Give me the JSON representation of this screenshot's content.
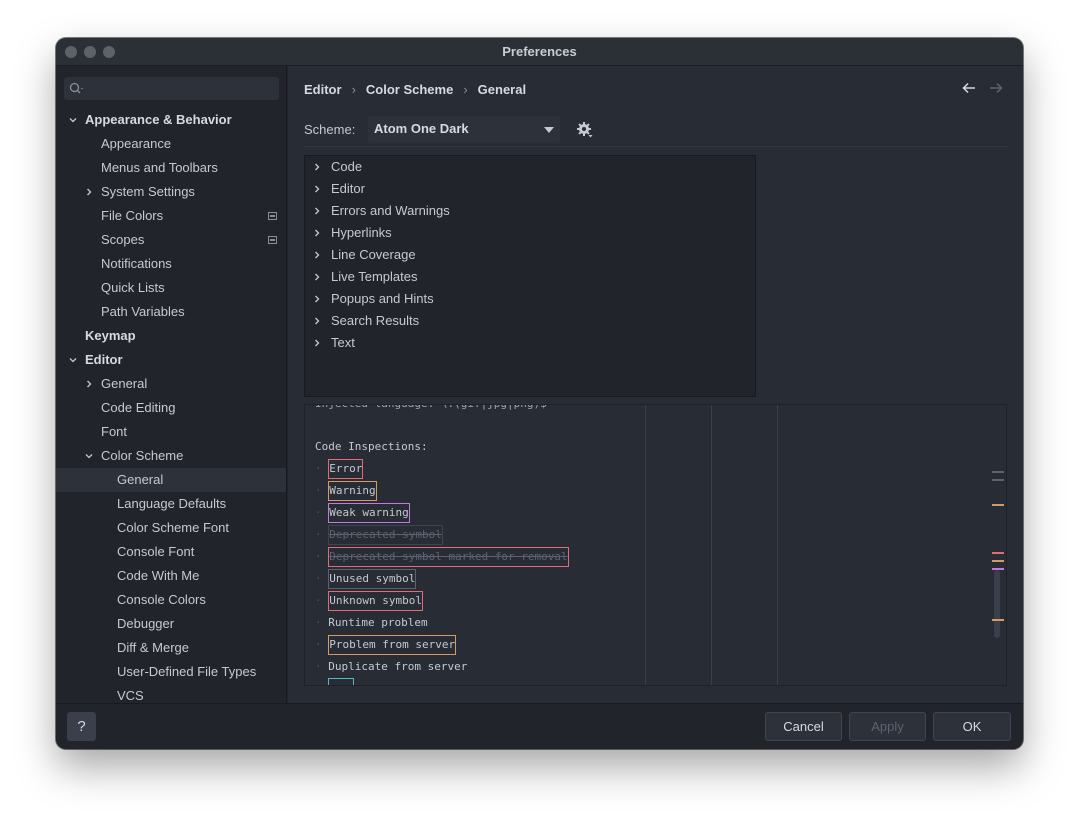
{
  "window": {
    "title": "Preferences"
  },
  "sidebar": {
    "search_placeholder": "",
    "items": [
      {
        "label": "Appearance & Behavior",
        "level": 0,
        "bold": true,
        "expanded": true,
        "chevron": "down"
      },
      {
        "label": "Appearance",
        "level": 1
      },
      {
        "label": "Menus and Toolbars",
        "level": 1
      },
      {
        "label": "System Settings",
        "level": 1,
        "chevron": "right"
      },
      {
        "label": "File Colors",
        "level": 1,
        "badge": true
      },
      {
        "label": "Scopes",
        "level": 1,
        "badge": true
      },
      {
        "label": "Notifications",
        "level": 1
      },
      {
        "label": "Quick Lists",
        "level": 1
      },
      {
        "label": "Path Variables",
        "level": 1
      },
      {
        "label": "Keymap",
        "level": 0,
        "bold": true
      },
      {
        "label": "Editor",
        "level": 0,
        "bold": true,
        "chevron": "down"
      },
      {
        "label": "General",
        "level": 1,
        "chevron": "right"
      },
      {
        "label": "Code Editing",
        "level": 1
      },
      {
        "label": "Font",
        "level": 1
      },
      {
        "label": "Color Scheme",
        "level": 1,
        "chevron": "down"
      },
      {
        "label": "General",
        "level": 2,
        "selected": true
      },
      {
        "label": "Language Defaults",
        "level": 2
      },
      {
        "label": "Color Scheme Font",
        "level": 2
      },
      {
        "label": "Console Font",
        "level": 2
      },
      {
        "label": "Code With Me",
        "level": 2
      },
      {
        "label": "Console Colors",
        "level": 2
      },
      {
        "label": "Debugger",
        "level": 2
      },
      {
        "label": "Diff & Merge",
        "level": 2
      },
      {
        "label": "User-Defined File Types",
        "level": 2
      },
      {
        "label": "VCS",
        "level": 2
      }
    ]
  },
  "breadcrumb": [
    "Editor",
    "Color Scheme",
    "General"
  ],
  "scheme": {
    "label": "Scheme:",
    "value": "Atom One Dark"
  },
  "categories": [
    "Code",
    "Editor",
    "Errors and Warnings",
    "Hyperlinks",
    "Line Coverage",
    "Live Templates",
    "Popups and Hints",
    "Search Results",
    "Text"
  ],
  "preview": {
    "partial_top_line": "Injected language: \\.(gif|jpg|png)$",
    "heading": "Code Inspections:",
    "lines": [
      {
        "text": "Error",
        "box": "#e06c75",
        "color": "#c5c9d1"
      },
      {
        "text": "Warning",
        "box": "#d19a66",
        "color": "#c5c9d1"
      },
      {
        "text": "Weak warning",
        "box": "#c678dd",
        "color": "#c5c9d1"
      },
      {
        "text": "Deprecated symbol",
        "box": "#3e4451",
        "color": "#5c6370",
        "strike": true
      },
      {
        "text": "Deprecated symbol marked for removal",
        "box": "#e06c75",
        "color": "#5c6370",
        "strike": true
      },
      {
        "text": "Unused symbol",
        "box": "#5c6370",
        "color": "#c5c9d1"
      },
      {
        "text": "Unknown symbol",
        "box": "#e06c75",
        "color": "#c5c9d1"
      },
      {
        "text": "Runtime problem",
        "box": "",
        "color": "#c5c9d1"
      },
      {
        "text": "Problem from server",
        "box": "#d19a66",
        "color": "#c5c9d1"
      },
      {
        "text": "Duplicate from server",
        "box": "",
        "color": "#c5c9d1"
      },
      {
        "text": "",
        "box": "#56b6c2",
        "color": "#c5c9d1"
      }
    ]
  },
  "footer": {
    "help": "?",
    "cancel": "Cancel",
    "apply": "Apply",
    "ok": "OK"
  },
  "colors": {
    "background": "#282c34",
    "sidebar": "#21252b",
    "selection": "#2c313a",
    "text": "#c5c9d1"
  }
}
